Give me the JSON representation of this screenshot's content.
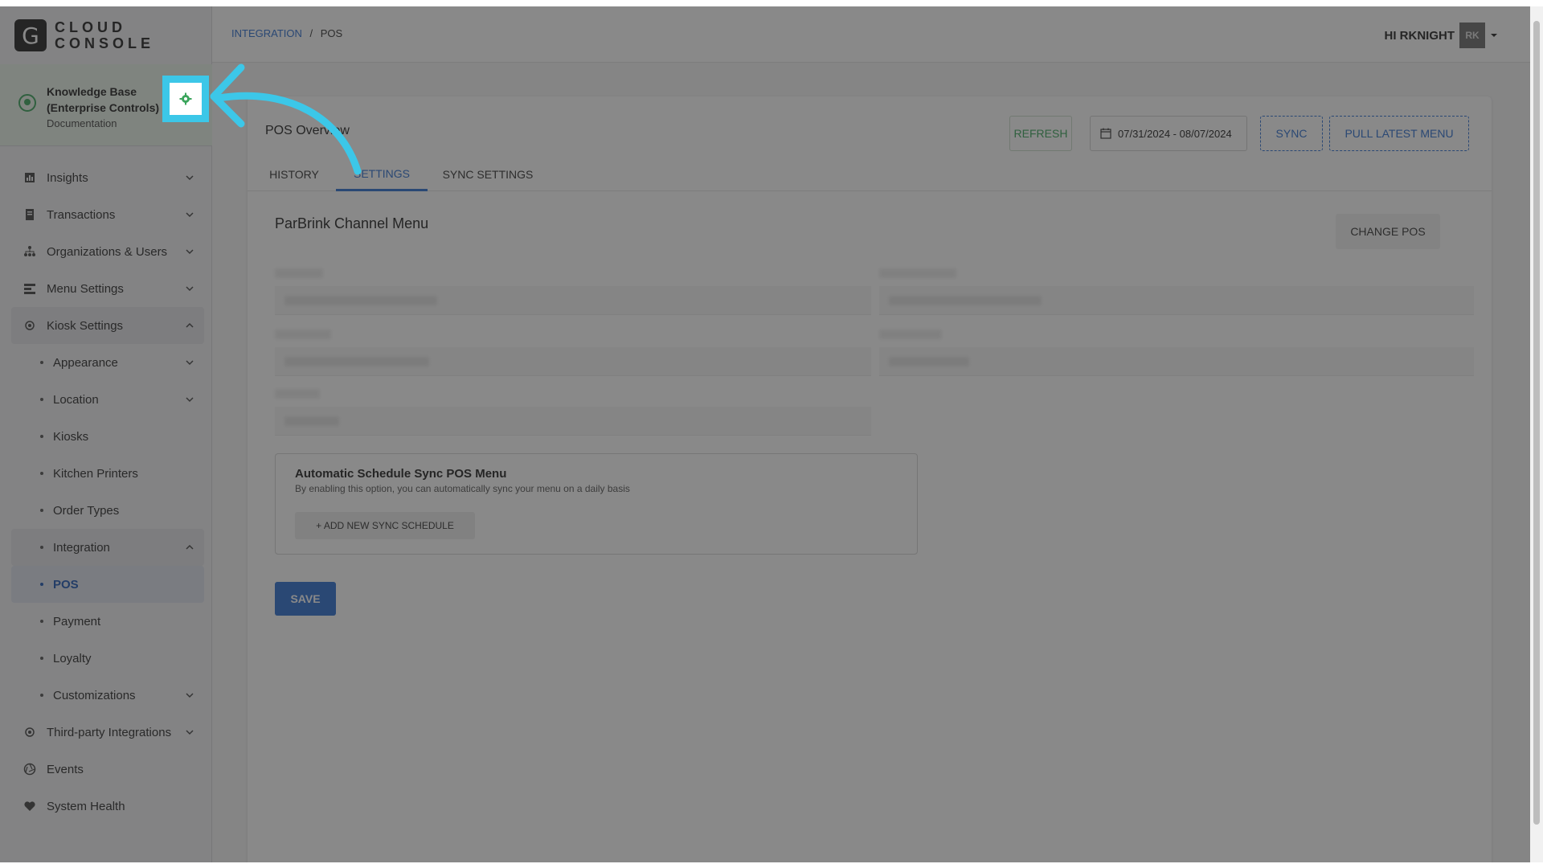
{
  "logo": {
    "letter": "G",
    "line1": "CLOUD",
    "line2": "CONSOLE"
  },
  "knowledge_base": {
    "title": "Knowledge Base (Enterprise Controls)",
    "subtitle": "Documentation"
  },
  "sidebar": {
    "items": [
      {
        "label": "Insights",
        "icon": "insights-icon",
        "chevron": "down"
      },
      {
        "label": "Transactions",
        "icon": "receipt-icon",
        "chevron": "down"
      },
      {
        "label": "Organizations & Users",
        "icon": "org-icon",
        "chevron": "down"
      },
      {
        "label": "Menu Settings",
        "icon": "menu-icon",
        "chevron": "down"
      },
      {
        "label": "Kiosk Settings",
        "icon": "gear-icon",
        "chevron": "up"
      },
      {
        "label": "Appearance",
        "sub": true,
        "chevron": "down"
      },
      {
        "label": "Location",
        "sub": true,
        "chevron": "down"
      },
      {
        "label": "Kiosks",
        "sub": true
      },
      {
        "label": "Kitchen Printers",
        "sub": true
      },
      {
        "label": "Order Types",
        "sub": true
      },
      {
        "label": "Integration",
        "sub": true,
        "chevron": "up"
      },
      {
        "label": "POS",
        "sub": true,
        "active": true
      },
      {
        "label": "Payment",
        "sub": true
      },
      {
        "label": "Loyalty",
        "sub": true
      },
      {
        "label": "Customizations",
        "sub": true,
        "chevron": "down"
      },
      {
        "label": "Third-party Integrations",
        "icon": "gear-icon",
        "chevron": "down"
      },
      {
        "label": "Events",
        "icon": "aperture-icon"
      },
      {
        "label": "System Health",
        "icon": "heart-icon"
      }
    ]
  },
  "header": {
    "breadcrumb_link": "INTEGRATION",
    "breadcrumb_sep": "/",
    "breadcrumb_current": "POS",
    "greeting": "HI RKNIGHT",
    "avatar": "RK"
  },
  "card": {
    "title": "POS Overview",
    "refresh": "REFRESH",
    "date_range": "07/31/2024 - 08/07/2024",
    "sync": "SYNC",
    "pull_latest": "PULL LATEST MENU",
    "tabs": [
      "HISTORY",
      "SETTINGS",
      "SYNC SETTINGS"
    ],
    "active_tab": "SETTINGS"
  },
  "section": {
    "title": "ParBrink Channel Menu",
    "change_pos": "CHANGE POS"
  },
  "schedule": {
    "title": "Automatic Schedule Sync POS Menu",
    "description": "By enabling this option, you can automatically sync your menu on a daily basis",
    "add_button": "+ ADD NEW SYNC SCHEDULE"
  },
  "save": "SAVE",
  "colors": {
    "accent": "#2d6fd0",
    "highlight": "#3cc7e8",
    "success": "#3ba55c"
  }
}
